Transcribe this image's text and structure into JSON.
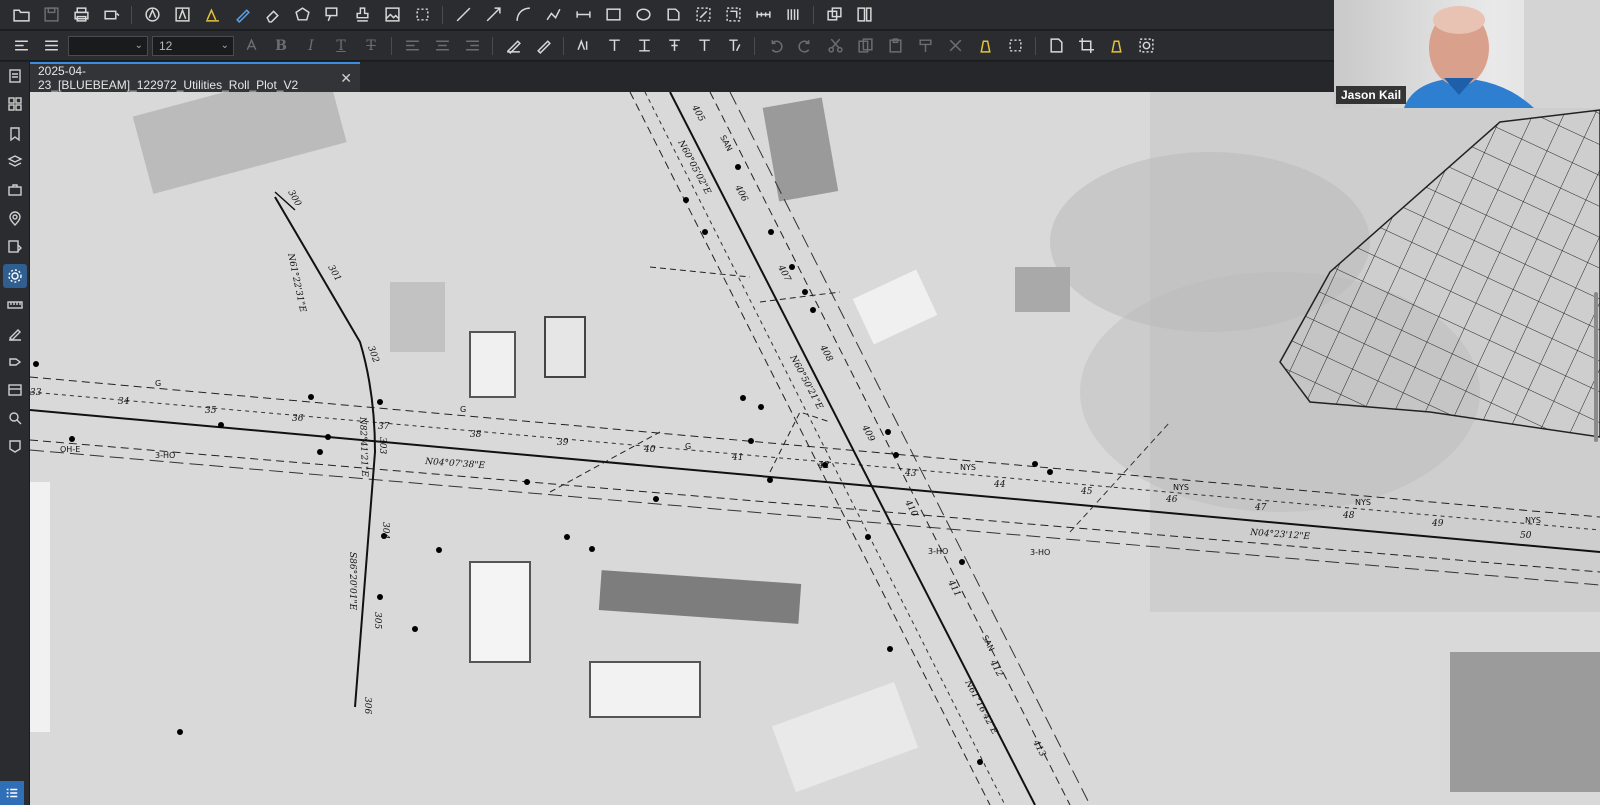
{
  "toolbar": {
    "row1_icons": [
      "folder-open-icon",
      "save-icon",
      "print-icon",
      "print-options-icon",
      "markup-icon",
      "text-box-icon",
      "highlight-icon",
      "pen-icon",
      "eraser-icon",
      "polygon-icon",
      "callout-icon",
      "stamp-icon",
      "image-icon",
      "crop-icon",
      "line-icon",
      "arrow-icon",
      "arc-icon",
      "polyline-icon",
      "dimension-icon",
      "rectangle-icon",
      "ellipse-icon",
      "cloud-icon",
      "area-measure-icon",
      "perimeter-measure-icon",
      "length-measure-icon",
      "count-icon",
      "snapshot-icon",
      "compare-icon"
    ],
    "font_value": "",
    "size_value": "12",
    "format_glyphs": {
      "bold": "B",
      "italic": "I",
      "underline": "T",
      "strike": "T"
    }
  },
  "tab": {
    "title": "2025-04-23_[BLUEBEAM]_122972_Utilities_Roll_Plot_V2",
    "close": "✕"
  },
  "webcam": {
    "name": "Jason Kail"
  },
  "map_labels": {
    "stations_main": [
      "33",
      "34",
      "35",
      "36",
      "37",
      "38",
      "39",
      "40",
      "41",
      "42",
      "43",
      "44",
      "45",
      "46",
      "47",
      "48",
      "49",
      "50"
    ],
    "stations_side": [
      "300",
      "301",
      "302",
      "303",
      "304",
      "305",
      "306",
      "405",
      "406",
      "407",
      "408",
      "409",
      "410",
      "411",
      "412",
      "413"
    ],
    "bearings": [
      "N04°07'38\"E",
      "N04°23'12\"E",
      "N61°22'31\"E",
      "N82°41'21\"E",
      "N60°05'02\"E",
      "N60°50'21\"E",
      "N61°16'42\"E",
      "S86°20'01\"E"
    ],
    "utility_tags": [
      "NYS",
      "NYS",
      "NYS",
      "NYS",
      "3-HO",
      "3-HO",
      "3-HO",
      "OH-E",
      "G",
      "G",
      "G",
      "SAN",
      "SAN"
    ]
  },
  "colors": {
    "accent": "#3a8de0",
    "toolbar_bg": "#2b2c30",
    "canvas_bg": "#d6d6d6"
  }
}
